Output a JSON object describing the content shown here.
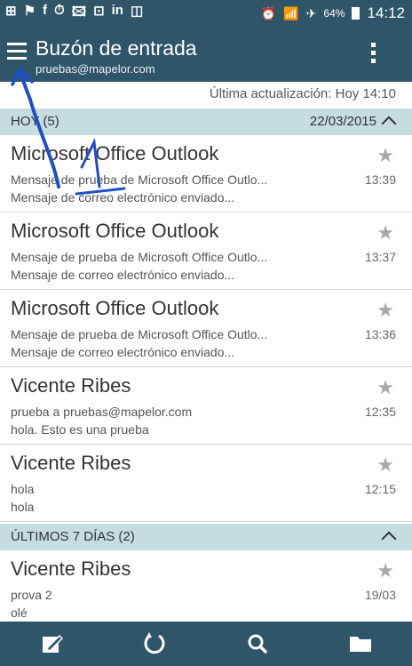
{
  "status_bar": {
    "icons": [
      "⊞",
      "⚑",
      "f",
      "⏱",
      "🖾",
      "⊡",
      "in",
      "◫",
      "⏰",
      "📶",
      "✈"
    ],
    "battery": "64%",
    "time": "14:12"
  },
  "app_bar": {
    "title": "Buzón de entrada",
    "account": "pruebas@mapelor.com"
  },
  "update": "Última actualización: Hoy 14:10",
  "sections": [
    {
      "name": "HOY (5)",
      "date": "22/03/2015"
    },
    {
      "name": "ÚLTIMOS 7 DÍAS (2)",
      "date": ""
    }
  ],
  "mails": [
    {
      "sender": "Microsoft Office Outlook",
      "subject": "Mensaje de prueba de Microsoft Office Outlo...",
      "preview": "Mensaje de correo electrónico enviado...",
      "time": "13:39"
    },
    {
      "sender": "Microsoft Office Outlook",
      "subject": "Mensaje de prueba de Microsoft Office Outlo...",
      "preview": "Mensaje de correo electrónico enviado...",
      "time": "13:37"
    },
    {
      "sender": "Microsoft Office Outlook",
      "subject": "Mensaje de prueba de Microsoft Office Outlo...",
      "preview": "Mensaje de correo electrónico enviado...",
      "time": "13:36"
    },
    {
      "sender": "Vicente Ribes",
      "subject": "prueba a pruebas@mapelor.com",
      "preview": "hola. Esto es una prueba",
      "time": "12:35"
    },
    {
      "sender": "Vicente Ribes",
      "subject": "hola",
      "preview": "hola",
      "time": "12:15"
    },
    {
      "sender": "Vicente Ribes",
      "subject": "prova 2",
      "preview": "olé",
      "time": "19/03"
    }
  ],
  "icons": {
    "menu": "menu-icon",
    "overflow": "more-vert-icon",
    "star": "star-icon",
    "compose": "compose-icon",
    "refresh": "refresh-icon",
    "search": "search-icon",
    "folder": "folder-icon"
  },
  "annotation_label": "1",
  "colors": {
    "primary": "#2e5668",
    "section": "#c5dde0",
    "annotation": "#1e4fc9"
  }
}
